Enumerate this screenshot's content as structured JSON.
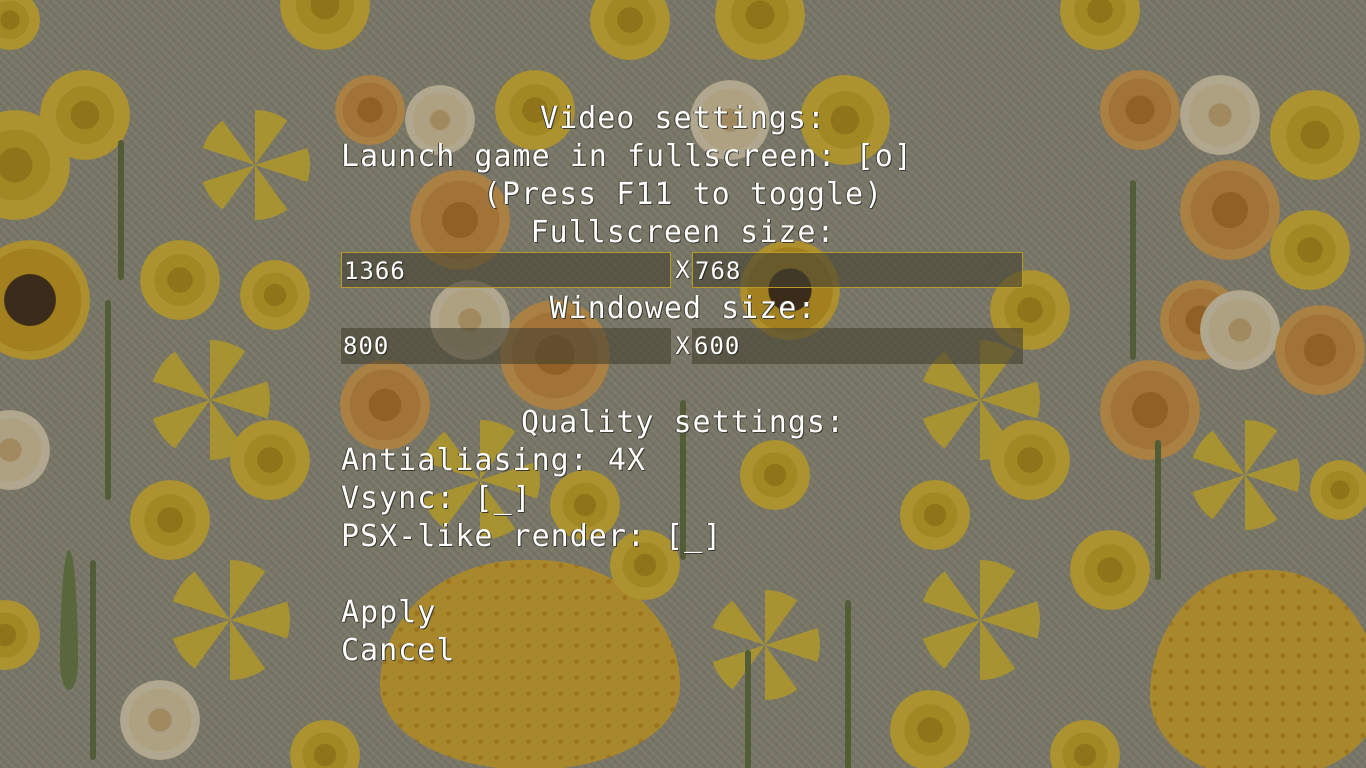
{
  "video": {
    "heading": "Video settings:",
    "fullscreen_label": "Launch game in fullscreen: [o]",
    "fullscreen_hint": "(Press F11 to toggle)",
    "fullscreen_size_heading": "Fullscreen size:",
    "fullscreen_width": "1366",
    "fullscreen_height": "768",
    "windowed_size_heading": "Windowed size:",
    "windowed_width": "800",
    "windowed_height": "600",
    "size_separator": "X"
  },
  "quality": {
    "heading": "Quality settings:",
    "antialiasing_label": "Antialiasing: 4X",
    "vsync_label": "Vsync: [_]",
    "psx_label": "PSX-like render: [_]"
  },
  "actions": {
    "apply_label": "Apply",
    "cancel_label": "Cancel"
  },
  "colors": {
    "text": "#ffffff",
    "field_background": "#46423280",
    "field_border_active": "#b79a28",
    "wallpaper_yellow": "#d8b52e"
  }
}
